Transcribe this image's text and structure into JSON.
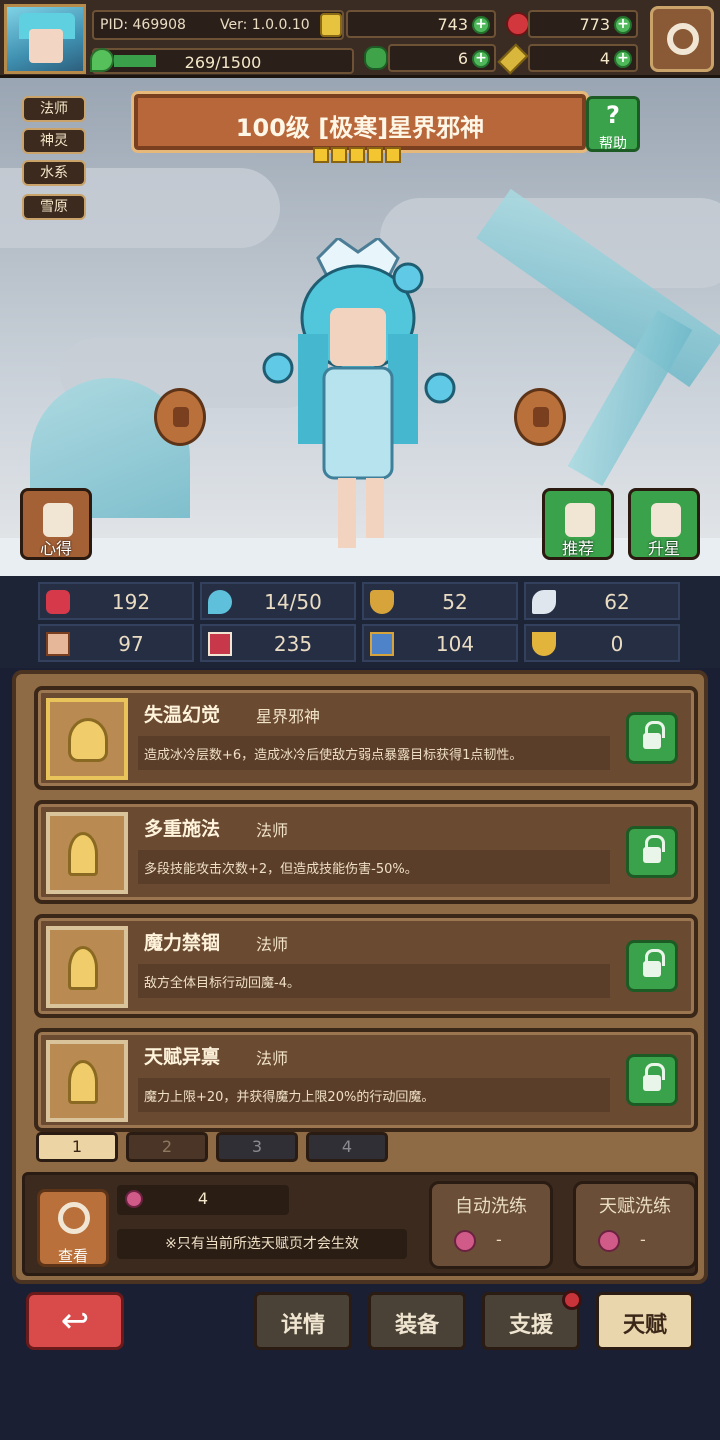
{
  "header": {
    "pid_label": "PID: 469908",
    "version_label": "Ver: 1.0.0.10",
    "gold": "743",
    "gems": "773",
    "clover": "6",
    "key": "4",
    "xp_text": "269/1500",
    "xp_progress": 0.1793
  },
  "tags": [
    "法师",
    "神灵",
    "水系",
    "雪原"
  ],
  "hero": {
    "title": "100级 [极寒]星界邪神",
    "stars": 5,
    "help_label": "帮助"
  },
  "side_buttons": {
    "left_label": "心得",
    "recommend_label": "推荐",
    "upgrade_label": "升星"
  },
  "stats": [
    {
      "icon": "heart-icon",
      "value": "192"
    },
    {
      "icon": "mana-drop-icon",
      "value": "14/50"
    },
    {
      "icon": "shield-icon",
      "value": "52"
    },
    {
      "icon": "wing-icon",
      "value": "62"
    },
    {
      "icon": "fist-icon",
      "value": "97"
    },
    {
      "icon": "spellbook-icon",
      "value": "235"
    },
    {
      "icon": "armor-icon",
      "value": "104"
    },
    {
      "icon": "crest-icon",
      "value": "0"
    }
  ],
  "talents": [
    {
      "name": "失温幻觉",
      "class": "星界邪神",
      "desc": "造成冰冷层数+6，造成冰冷后使敌方弱点暴露目标获得1点韧性。"
    },
    {
      "name": "多重施法",
      "class": "法师",
      "desc": "多段技能攻击次数+2，但造成技能伤害-50%。"
    },
    {
      "name": "魔力禁锢",
      "class": "法师",
      "desc": "敌方全体目标行动回魔-4。"
    },
    {
      "name": "天赋异禀",
      "class": "法师",
      "desc": "魔力上限+20，并获得魔力上限20%的行动回魔。"
    }
  ],
  "pages": [
    "1",
    "2",
    "3",
    "4"
  ],
  "bottom": {
    "view_label": "查看",
    "count": "4",
    "notice": "※只有当前所选天赋页才会生效",
    "auto_wash_label": "自动洗练",
    "auto_wash_value": "-",
    "talent_wash_label": "天赋洗练",
    "talent_wash_value": "-"
  },
  "nav": {
    "details": "详情",
    "equipment": "装备",
    "support": "支援",
    "talent": "天赋"
  }
}
